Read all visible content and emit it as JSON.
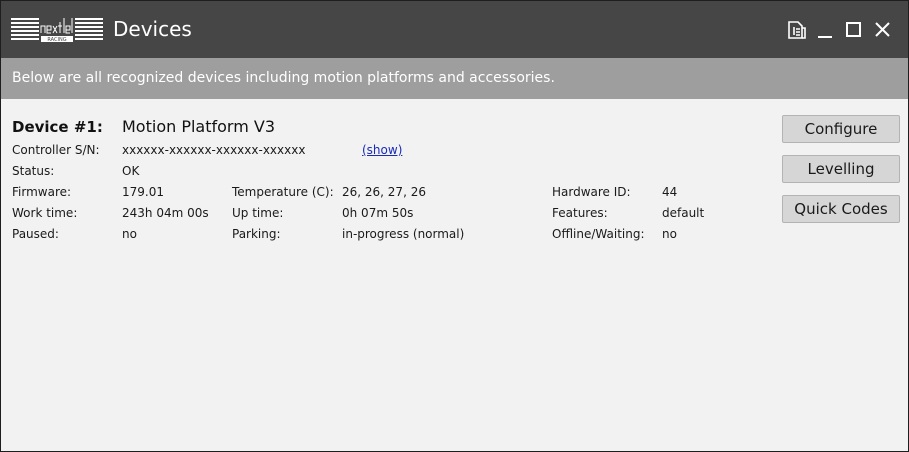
{
  "window": {
    "title": "Devices",
    "logo_icon": "next-level-racing-logo",
    "controls": [
      "document-icon",
      "minimize-icon",
      "maximize-icon",
      "close-icon"
    ]
  },
  "banner": {
    "text": "Below are all recognized devices including motion platforms and accessories."
  },
  "device": {
    "label": "Device #1:",
    "name": "Motion Platform V3",
    "serial_label": "Controller S/N:",
    "serial_value": "xxxxxx-xxxxxx-xxxxxx-xxxxxx",
    "show_link": "(show)",
    "status_label": "Status:",
    "status_value": "OK",
    "firmware_label": "Firmware:",
    "firmware_value": "179.01",
    "temperature_label": "Temperature (C):",
    "temperature_value": "26, 26, 27, 26",
    "hardware_id_label": "Hardware ID:",
    "hardware_id_value": "44",
    "work_time_label": "Work time:",
    "work_time_value": "243h 04m 00s",
    "up_time_label": "Up time:",
    "up_time_value": "0h 07m 50s",
    "features_label": "Features:",
    "features_value": "default",
    "paused_label": "Paused:",
    "paused_value": "no",
    "parking_label": "Parking:",
    "parking_value": "in-progress (normal)",
    "offline_label": "Offline/Waiting:",
    "offline_value": "no"
  },
  "actions": {
    "configure": "Configure",
    "levelling": "Levelling",
    "quick_codes": "Quick Codes"
  },
  "colors": {
    "titlebar": "#464646",
    "banner": "#9e9e9e",
    "background": "#f2f2f2",
    "link": "#1a2bb8"
  }
}
